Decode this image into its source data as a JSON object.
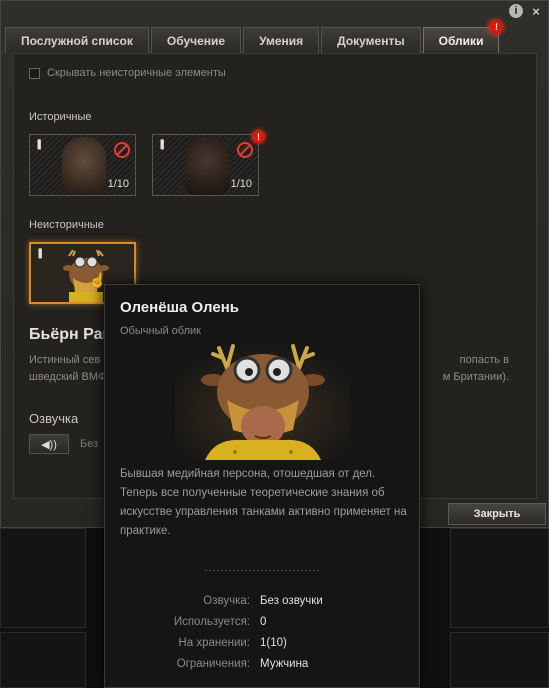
{
  "window": {
    "info_icon": "i",
    "close_icon": "×"
  },
  "tabs": [
    {
      "label": "Послужной список"
    },
    {
      "label": "Обучение"
    },
    {
      "label": "Умения"
    },
    {
      "label": "Документы"
    },
    {
      "label": "Облики",
      "active": true,
      "badge": "!"
    }
  ],
  "filters": {
    "hide_nonhistorical_label": "Скрывать неисторичные элементы",
    "hide_nonhistorical_checked": false
  },
  "sections": {
    "historical_label": "Историчные",
    "nonhistorical_label": "Неисторичные"
  },
  "skins": {
    "historical": [
      {
        "count": "1/10",
        "restricted": true,
        "alert": false,
        "icons": [
          "lamp-icon",
          "ban-icon"
        ]
      },
      {
        "count": "1/10",
        "restricted": true,
        "alert": true,
        "alert_text": "!",
        "icons": [
          "lamp-icon",
          "ban-icon"
        ]
      }
    ],
    "nonhistorical": [
      {
        "selected": true,
        "icons": [
          "lamp-icon",
          "cursor-icon"
        ]
      }
    ],
    "lamp_glyph": "❚"
  },
  "crew": {
    "name": "Бьёрн Рагі",
    "desc_line1_left": "Истинный сев",
    "desc_line1_right": "попасть в",
    "desc_line2_left": "шведский ВМФ",
    "desc_line2_right": "м Британии)."
  },
  "voice": {
    "label": "Озвучка",
    "button_glyph": "◀))",
    "value": "Без"
  },
  "close_button": {
    "label": "Закрыть"
  },
  "tooltip": {
    "title": "Оленёша Олень",
    "subtitle": "Обычный облик",
    "description": "Бывшая медийная персона, отошедшая от дел. Теперь все полученные теоретические знания об искусстве управления танками активно применяет на практике.",
    "props": [
      {
        "key": "Озвучка:",
        "value": "Без озвучки"
      },
      {
        "key": "Используется:",
        "value": "0"
      },
      {
        "key": "На хранении:",
        "value": "1(10)"
      },
      {
        "key": "Ограничения:",
        "value": "Мужчина"
      }
    ]
  },
  "colors": {
    "accent": "#d98a2b",
    "alert": "#d11b0b",
    "restricted": "#e63b2e"
  }
}
